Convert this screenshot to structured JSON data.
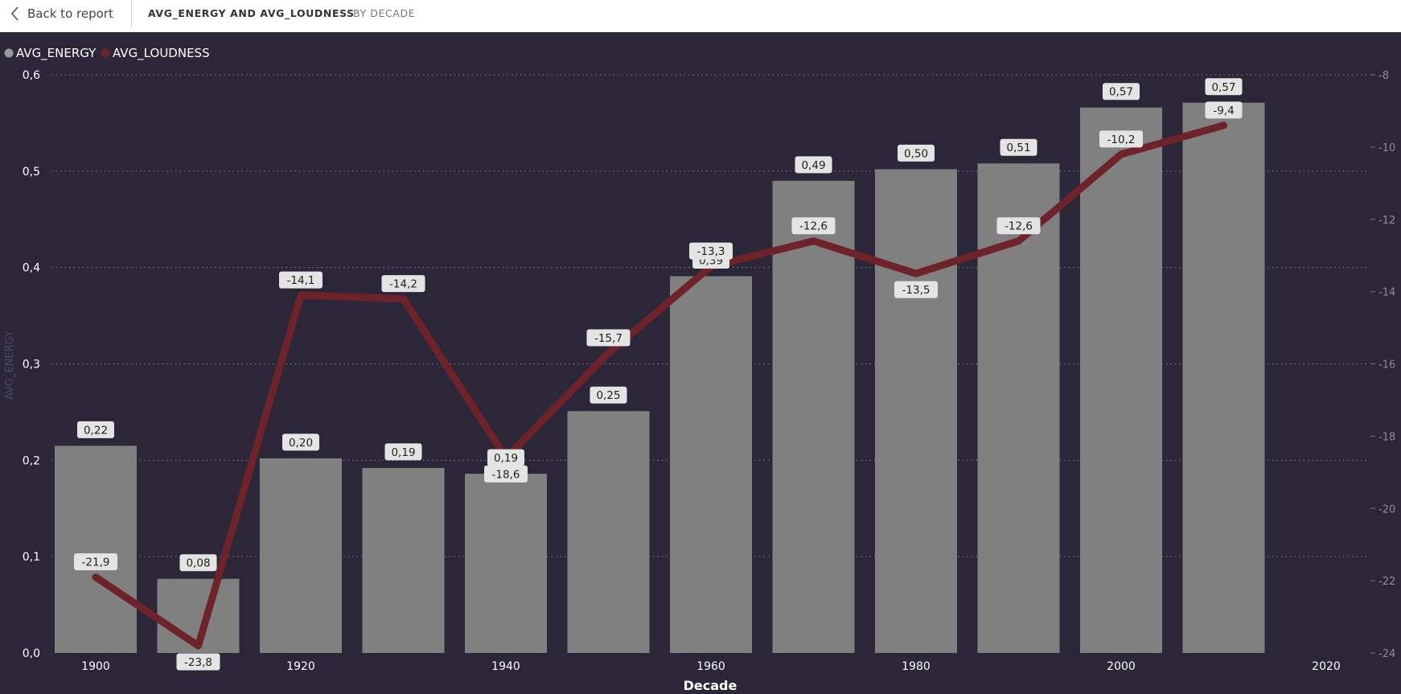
{
  "header": {
    "back_label": "Back to report",
    "title": "AVG_ENERGY AND AVG_LOUDNESS",
    "subtitle": "BY DECADE"
  },
  "colors": {
    "background": "#2b2738",
    "bar": "#808080",
    "line": "#6e2229",
    "label_bg": "#e4e4e4"
  },
  "chart_data": {
    "type": "bar",
    "combo": "bar + line (dual axis)",
    "legend_position": "top-left",
    "xlabel": "Decade",
    "ylabel": "AVG_ENERGY",
    "y2label": "",
    "x_ticks": [
      "1900",
      "1920",
      "1940",
      "1960",
      "1980",
      "2000",
      "2020"
    ],
    "y_ticks": [
      "0,0",
      "0,1",
      "0,2",
      "0,3",
      "0,4",
      "0,5",
      "0,6"
    ],
    "y2_ticks": [
      "-24",
      "-22",
      "-20",
      "-18",
      "-16",
      "-14",
      "-12",
      "-10",
      "-8"
    ],
    "ylim": [
      0,
      0.6
    ],
    "y2lim": [
      -24,
      -8
    ],
    "grid": true,
    "categories": [
      1900,
      1910,
      1920,
      1930,
      1940,
      1950,
      1960,
      1970,
      1980,
      1990,
      2000,
      2010
    ],
    "series": [
      {
        "name": "AVG_ENERGY",
        "type": "bar",
        "axis": "left",
        "values": [
          0.215,
          0.077,
          0.202,
          0.192,
          0.186,
          0.251,
          0.391,
          0.49,
          0.502,
          0.508,
          0.566,
          0.571
        ],
        "labels": [
          "0,22",
          "0,08",
          "0,20",
          "0,19",
          "0,19",
          "0,25",
          "0,39",
          "0,49",
          "0,50",
          "0,51",
          "0,57",
          "0,57"
        ]
      },
      {
        "name": "AVG_LOUDNESS",
        "type": "line",
        "axis": "right",
        "values": [
          -21.9,
          -23.8,
          -14.1,
          -14.2,
          -18.6,
          -15.7,
          -13.3,
          -12.6,
          -13.5,
          -12.6,
          -10.2,
          -9.4
        ],
        "labels": [
          "-21,9",
          "-23,8",
          "-14,1",
          "-14,2",
          "-18,6",
          "-15,7",
          "-13,3",
          "-12,6",
          "-13,5",
          "-12,6",
          "-10,2",
          "-9,4"
        ]
      }
    ]
  }
}
